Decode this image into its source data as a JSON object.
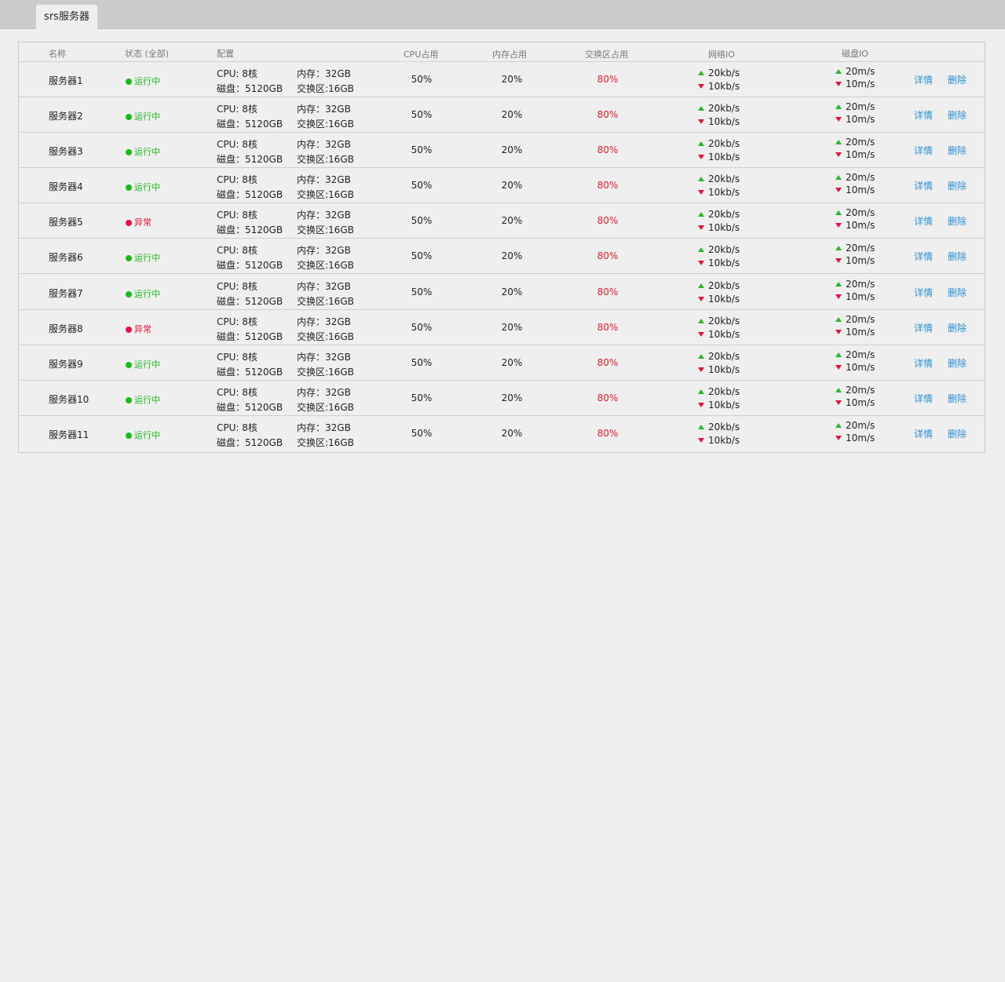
{
  "tab": {
    "label": "srs服务器"
  },
  "header": {
    "name": "名称",
    "status": "状态 (全部)",
    "config": "配置",
    "cpu": "CPU占用",
    "mem": "内存占用",
    "swap": "交换区占用",
    "net": "网络IO",
    "disk": "磁盘IO"
  },
  "colors": {
    "running": "#1cb91c",
    "error": "#e0143c",
    "swap": "#d81c2c",
    "action": "#2a8fd0",
    "up": "#2cb52c",
    "down": "#e0143c"
  },
  "rows": [
    {
      "name": "服务器1",
      "status": "运行中",
      "state": "running",
      "cfg_cpu": "CPU:  8核",
      "cfg_mem": "内存：32GB",
      "cfg_disk": "磁盘：5120GB",
      "cfg_swap": "交换区:16GB",
      "cpu": "50%",
      "mem": "20%",
      "swap": "80%",
      "net_up": "20kb/s",
      "net_down": "10kb/s",
      "disk_up": "20m/s",
      "disk_down": "10m/s",
      "detail": "详情",
      "delete": "删除"
    },
    {
      "name": "服务器2",
      "status": "运行中",
      "state": "running",
      "cfg_cpu": "CPU:  8核",
      "cfg_mem": "内存：32GB",
      "cfg_disk": "磁盘：5120GB",
      "cfg_swap": "交换区:16GB",
      "cpu": "50%",
      "mem": "20%",
      "swap": "80%",
      "net_up": "20kb/s",
      "net_down": "10kb/s",
      "disk_up": "20m/s",
      "disk_down": "10m/s",
      "detail": "详情",
      "delete": "删除"
    },
    {
      "name": "服务器3",
      "status": "运行中",
      "state": "running",
      "cfg_cpu": "CPU:  8核",
      "cfg_mem": "内存：32GB",
      "cfg_disk": "磁盘：5120GB",
      "cfg_swap": "交换区:16GB",
      "cpu": "50%",
      "mem": "20%",
      "swap": "80%",
      "net_up": "20kb/s",
      "net_down": "10kb/s",
      "disk_up": "20m/s",
      "disk_down": "10m/s",
      "detail": "详情",
      "delete": "删除"
    },
    {
      "name": "服务器4",
      "status": "运行中",
      "state": "running",
      "cfg_cpu": "CPU:  8核",
      "cfg_mem": "内存：32GB",
      "cfg_disk": "磁盘：5120GB",
      "cfg_swap": "交换区:16GB",
      "cpu": "50%",
      "mem": "20%",
      "swap": "80%",
      "net_up": "20kb/s",
      "net_down": "10kb/s",
      "disk_up": "20m/s",
      "disk_down": "10m/s",
      "detail": "详情",
      "delete": "删除"
    },
    {
      "name": "服务器5",
      "status": "异常",
      "state": "error",
      "cfg_cpu": "CPU:  8核",
      "cfg_mem": "内存：32GB",
      "cfg_disk": "磁盘：5120GB",
      "cfg_swap": "交换区:16GB",
      "cpu": "50%",
      "mem": "20%",
      "swap": "80%",
      "net_up": "20kb/s",
      "net_down": "10kb/s",
      "disk_up": "20m/s",
      "disk_down": "10m/s",
      "detail": "详情",
      "delete": "删除"
    },
    {
      "name": "服务器6",
      "status": "运行中",
      "state": "running",
      "cfg_cpu": "CPU:  8核",
      "cfg_mem": "内存：32GB",
      "cfg_disk": "磁盘：5120GB",
      "cfg_swap": "交换区:16GB",
      "cpu": "50%",
      "mem": "20%",
      "swap": "80%",
      "net_up": "20kb/s",
      "net_down": "10kb/s",
      "disk_up": "20m/s",
      "disk_down": "10m/s",
      "detail": "详情",
      "delete": "删除"
    },
    {
      "name": "服务器7",
      "status": "运行中",
      "state": "running",
      "cfg_cpu": "CPU:  8核",
      "cfg_mem": "内存：32GB",
      "cfg_disk": "磁盘：5120GB",
      "cfg_swap": "交换区:16GB",
      "cpu": "50%",
      "mem": "20%",
      "swap": "80%",
      "net_up": "20kb/s",
      "net_down": "10kb/s",
      "disk_up": "20m/s",
      "disk_down": "10m/s",
      "detail": "详情",
      "delete": "删除"
    },
    {
      "name": "服务器8",
      "status": "异常",
      "state": "error",
      "cfg_cpu": "CPU:  8核",
      "cfg_mem": "内存：32GB",
      "cfg_disk": "磁盘：5120GB",
      "cfg_swap": "交换区:16GB",
      "cpu": "50%",
      "mem": "20%",
      "swap": "80%",
      "net_up": "20kb/s",
      "net_down": "10kb/s",
      "disk_up": "20m/s",
      "disk_down": "10m/s",
      "detail": "详情",
      "delete": "删除"
    },
    {
      "name": "服务器9",
      "status": "运行中",
      "state": "running",
      "cfg_cpu": "CPU:  8核",
      "cfg_mem": "内存：32GB",
      "cfg_disk": "磁盘：5120GB",
      "cfg_swap": "交换区:16GB",
      "cpu": "50%",
      "mem": "20%",
      "swap": "80%",
      "net_up": "20kb/s",
      "net_down": "10kb/s",
      "disk_up": "20m/s",
      "disk_down": "10m/s",
      "detail": "详情",
      "delete": "删除"
    },
    {
      "name": "服务器10",
      "status": "运行中",
      "state": "running",
      "cfg_cpu": "CPU:  8核",
      "cfg_mem": "内存：32GB",
      "cfg_disk": "磁盘：5120GB",
      "cfg_swap": "交换区:16GB",
      "cpu": "50%",
      "mem": "20%",
      "swap": "80%",
      "net_up": "20kb/s",
      "net_down": "10kb/s",
      "disk_up": "20m/s",
      "disk_down": "10m/s",
      "detail": "详情",
      "delete": "删除"
    },
    {
      "name": "服务器11",
      "status": "运行中",
      "state": "running",
      "cfg_cpu": "CPU:  8核",
      "cfg_mem": "内存：32GB",
      "cfg_disk": "磁盘：5120GB",
      "cfg_swap": "交换区:16GB",
      "cpu": "50%",
      "mem": "20%",
      "swap": "80%",
      "net_up": "20kb/s",
      "net_down": "10kb/s",
      "disk_up": "20m/s",
      "disk_down": "10m/s",
      "detail": "详情",
      "delete": "删除"
    }
  ]
}
